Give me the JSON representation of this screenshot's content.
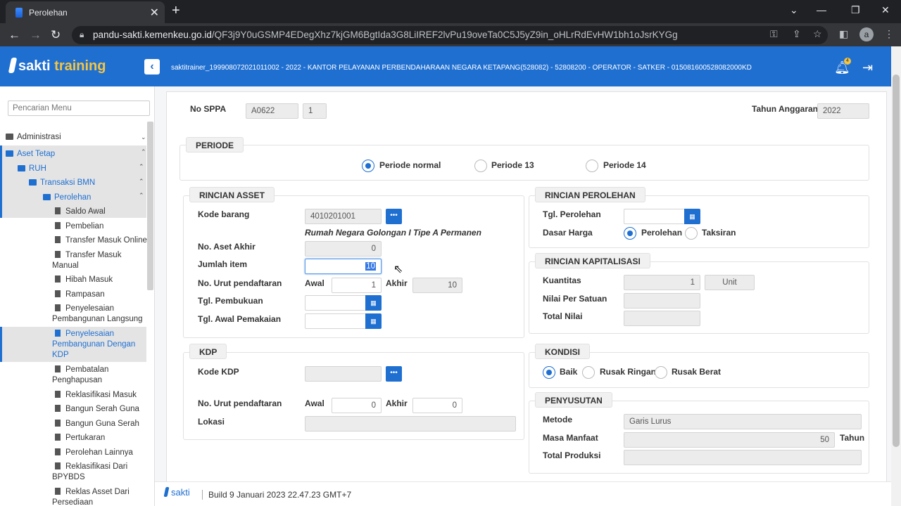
{
  "browser": {
    "tab_title": "Perolehan",
    "url_host": "pandu-sakti.kemenkeu.go.id",
    "url_path": "/QF3j9Y0uGSMP4EDegXhz7kjGM6BgtIda3G8LiIREF2lvPu19oveTa0C5J5yZ9in_oHLrRdEvHW1bh1oJsrKYGg",
    "avatar_letter": "a"
  },
  "app": {
    "logo_a": "sakti",
    "logo_b": "training",
    "user_info": "saktitrainer_199908072021011002 - 2022 - KANTOR PELAYANAN PERBENDAHARAAN NEGARA KETAPANG(528082) - 52808200 - OPERATOR - SATKER - 015081600528082000KD",
    "notif_count": "4"
  },
  "sidebar": {
    "search_placeholder": "Pencarian Menu",
    "items": [
      {
        "label": "Administrasi"
      },
      {
        "label": "Aset Tetap"
      },
      {
        "label": "RUH"
      },
      {
        "label": "Transaksi BMN"
      },
      {
        "label": "Perolehan"
      },
      {
        "label": "Saldo Awal"
      },
      {
        "label": "Pembelian"
      },
      {
        "label": "Transfer Masuk Online"
      },
      {
        "label": "Transfer Masuk",
        "label2": "Manual"
      },
      {
        "label": "Hibah Masuk"
      },
      {
        "label": "Rampasan"
      },
      {
        "label": "Penyelesaian",
        "label2": "Pembangunan Langsung"
      },
      {
        "label": "Penyelesaian",
        "label2": "Pembangunan Dengan",
        "label3": "KDP"
      },
      {
        "label": "Pembatalan",
        "label2": "Penghapusan"
      },
      {
        "label": "Reklasifikasi Masuk"
      },
      {
        "label": "Bangun Serah Guna"
      },
      {
        "label": "Bangun Guna Serah"
      },
      {
        "label": "Pertukaran"
      },
      {
        "label": "Perolehan Lainnya"
      },
      {
        "label": "Reklasifikasi Dari",
        "label2": "BPYBDS"
      },
      {
        "label": "Reklas Asset Dari",
        "label2": "Persediaan"
      }
    ]
  },
  "form": {
    "no_sppa_label": "No SPPA",
    "no_sppa_value": "A0622",
    "no_sppa_seq": "1",
    "tahun_label": "Tahun Anggaran",
    "tahun_value": "2022",
    "periode": {
      "title": "PERIODE",
      "options": [
        "Periode normal",
        "Periode 13",
        "Periode 14"
      ],
      "selected": "Periode normal"
    },
    "rincian_asset": {
      "title": "RINCIAN ASSET",
      "kode_barang_label": "Kode barang",
      "kode_barang_value": "4010201001",
      "kode_barang_desc": "Rumah Negara Golongan I Tipe A Permanen",
      "no_aset_akhir_label": "No. Aset Akhir",
      "no_aset_akhir_value": "0",
      "jumlah_item_label": "Jumlah item",
      "jumlah_item_value": "10",
      "no_urut_label": "No. Urut pendaftaran",
      "awal_label": "Awal",
      "awal_value": "1",
      "akhir_label": "Akhir",
      "akhir_value": "10",
      "tgl_pembukuan_label": "Tgl. Pembukuan",
      "tgl_awal_pemakaian_label": "Tgl. Awal Pemakaian"
    },
    "kdp": {
      "title": "KDP",
      "kode_kdp_label": "Kode KDP",
      "no_urut_label": "No. Urut pendaftaran",
      "awal_label": "Awal",
      "awal_value": "0",
      "akhir_label": "Akhir",
      "akhir_value": "0",
      "lokasi_label": "Lokasi"
    },
    "rincian_perolehan": {
      "title": "RINCIAN PEROLEHAN",
      "tgl_label": "Tgl. Perolehan",
      "dasar_harga_label": "Dasar Harga",
      "options": [
        "Perolehan",
        "Taksiran"
      ],
      "selected": "Perolehan"
    },
    "rincian_kapitalisasi": {
      "title": "RINCIAN KAPITALISASI",
      "kuantitas_label": "Kuantitas",
      "kuantitas_value": "1",
      "unit_label": "Unit",
      "nilai_per_satuan_label": "Nilai Per Satuan",
      "total_nilai_label": "Total Nilai"
    },
    "kondisi": {
      "title": "KONDISI",
      "options": [
        "Baik",
        "Rusak Ringan",
        "Rusak Berat"
      ],
      "selected": "Baik"
    },
    "penyusutan": {
      "title": "PENYUSUTAN",
      "metode_label": "Metode",
      "metode_value": "Garis Lurus",
      "masa_manfaat_label": "Masa Manfaat",
      "masa_manfaat_value": "50",
      "masa_unit": "Tahun",
      "total_produksi_label": "Total Produksi"
    }
  },
  "footer": {
    "logo": "sakti",
    "build": "Build 9 Januari 2023 22.47.23 GMT+7"
  }
}
